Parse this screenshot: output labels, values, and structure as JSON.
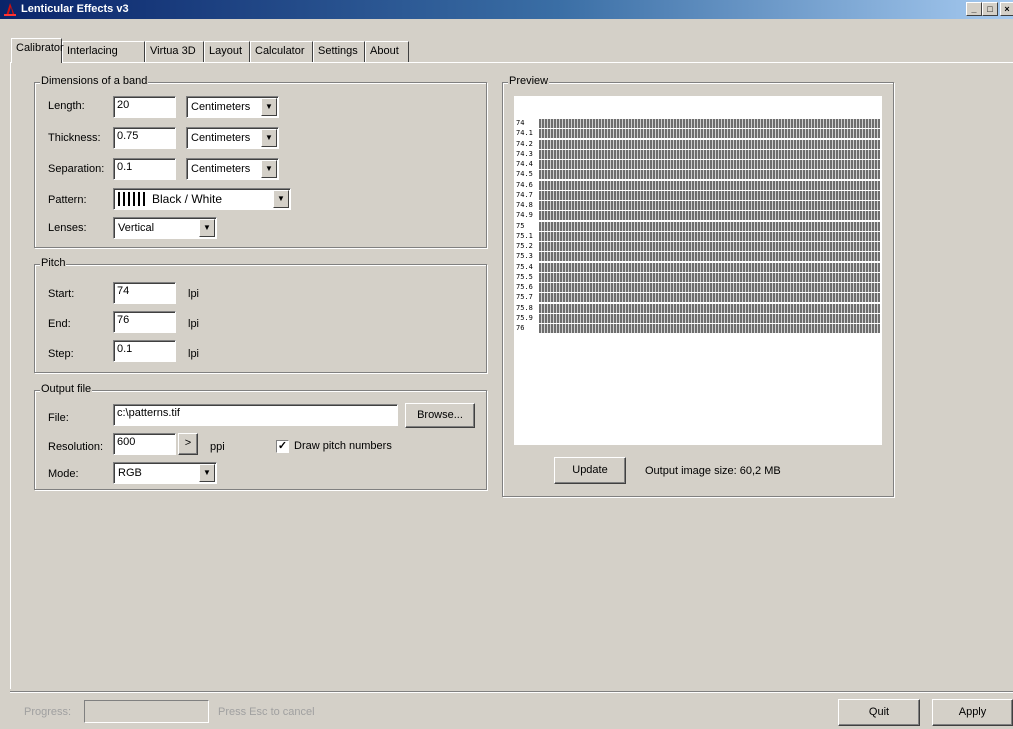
{
  "window": {
    "title": "Lenticular Effects v3",
    "controls": {
      "minimize": "_",
      "maximize": "□",
      "close": "×"
    }
  },
  "tabs": [
    {
      "label": "Calibrator",
      "active": true
    },
    {
      "label": "Interlacing"
    },
    {
      "label": "Virtua 3D"
    },
    {
      "label": "Layout"
    },
    {
      "label": "Calculator"
    },
    {
      "label": "Settings"
    },
    {
      "label": "About"
    }
  ],
  "dimensions": {
    "legend": "Dimensions of a band",
    "length": {
      "label": "Length:",
      "value": "20",
      "unit": "Centimeters"
    },
    "thickness": {
      "label": "Thickness:",
      "value": "0.75",
      "unit": "Centimeters"
    },
    "separation": {
      "label": "Separation:",
      "value": "0.1",
      "unit": "Centimeters"
    },
    "pattern": {
      "label": "Pattern:",
      "value": "Black / White"
    },
    "lenses": {
      "label": "Lenses:",
      "value": "Vertical"
    }
  },
  "pitch": {
    "legend": "Pitch",
    "start": {
      "label": "Start:",
      "value": "74",
      "unit": "lpi"
    },
    "end": {
      "label": "End:",
      "value": "76",
      "unit": "lpi"
    },
    "step": {
      "label": "Step:",
      "value": "0.1",
      "unit": "lpi"
    }
  },
  "output": {
    "legend": "Output file",
    "file": {
      "label": "File:",
      "value": "c:\\patterns.tif",
      "browse": "Browse..."
    },
    "resolution": {
      "label": "Resolution:",
      "value": "600",
      "stepper": ">",
      "unit": "ppi"
    },
    "draw_pitch_numbers": {
      "label": "Draw pitch numbers",
      "checked": true,
      "mark": "✓"
    },
    "mode": {
      "label": "Mode:",
      "value": "RGB"
    }
  },
  "preview": {
    "legend": "Preview",
    "pitch_labels": [
      "74",
      "74.1",
      "74.2",
      "74.3",
      "74.4",
      "74.5",
      "74.6",
      "74.7",
      "74.8",
      "74.9",
      "75",
      "75.1",
      "75.2",
      "75.3",
      "75.4",
      "75.5",
      "75.6",
      "75.7",
      "75.8",
      "75.9",
      "76"
    ],
    "update_button": "Update",
    "output_size": "Output image size: 60,2 MB"
  },
  "status": {
    "progress_label": "Progress:",
    "progress_value": 0,
    "cancel_hint": "Press Esc to cancel",
    "quit_button": "Quit",
    "apply_button": "Apply"
  },
  "colors": {
    "titlebar_start": "#0a246a",
    "titlebar_end": "#a6caf0",
    "face": "#d4d0c8",
    "app_icon": "#cc1111"
  },
  "icons": {
    "app": "lenticular-logo-icon",
    "dropdown": "chevron-down-icon",
    "check": "checkmark-icon"
  }
}
